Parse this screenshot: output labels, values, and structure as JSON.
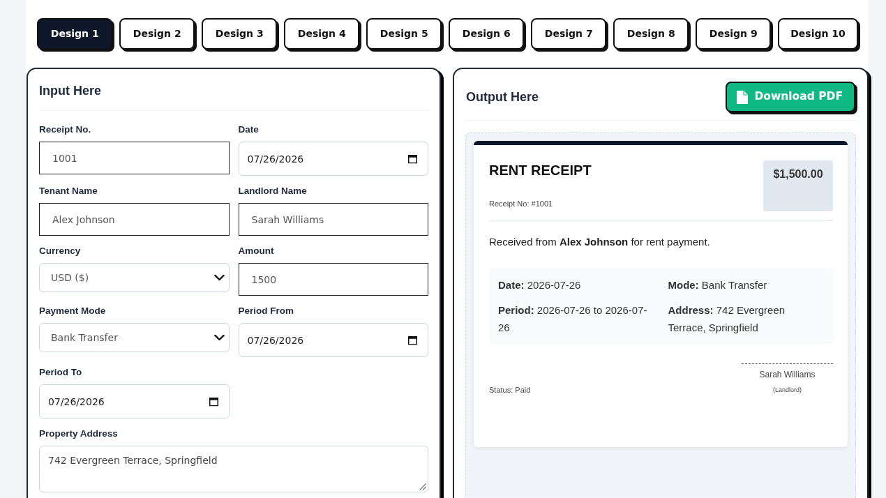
{
  "tabs": [
    {
      "label": "Design 1",
      "selected": true
    },
    {
      "label": "Design 2",
      "selected": false
    },
    {
      "label": "Design 3",
      "selected": false
    },
    {
      "label": "Design 4",
      "selected": false
    },
    {
      "label": "Design 5",
      "selected": false
    },
    {
      "label": "Design 6",
      "selected": false
    },
    {
      "label": "Design 7",
      "selected": false
    },
    {
      "label": "Design 8",
      "selected": false
    },
    {
      "label": "Design 9",
      "selected": false
    },
    {
      "label": "Design 10",
      "selected": false
    }
  ],
  "input_panel": {
    "title": "Input Here",
    "fields": [
      {
        "label": "Receipt No.",
        "kind": "text",
        "value": "1001"
      },
      {
        "label": "Date",
        "kind": "date",
        "value": "07/26/2026"
      },
      {
        "label": "Tenant Name",
        "kind": "text",
        "value": "Alex Johnson"
      },
      {
        "label": "Landlord Name",
        "kind": "text",
        "value": "Sarah Williams"
      },
      {
        "label": "Currency",
        "kind": "select",
        "value": "USD ($)"
      },
      {
        "label": "Amount",
        "kind": "text",
        "value": "1500"
      },
      {
        "label": "Payment Mode",
        "kind": "select",
        "value": "Bank Transfer"
      },
      {
        "label": "Period From",
        "kind": "date",
        "value": "07/26/2026"
      },
      {
        "label": "Period To",
        "kind": "date",
        "value": "07/26/2026"
      },
      {
        "label": "Property Address",
        "kind": "textarea",
        "value": "742 Evergreen Terrace, Springfield"
      }
    ]
  },
  "output_panel": {
    "title": "Output Here",
    "download_button": "Download PDF",
    "receipt": {
      "title": "RENT RECEIPT",
      "amount": "$1,500.00",
      "receipt_no": "Receipt No: #1001",
      "statement": "Received from **Alex Johnson** for rent payment.",
      "details": [
        "**Date:** 2026-07-26",
        "**Mode:** Bank Transfer",
        "**Period:** 2026-07-26 to 2026-07-26",
        "**Address:** 742 Evergreen Terrace, Springfield"
      ],
      "status": "Status: Paid",
      "signature_name": "Sarah Williams",
      "signature_role": "(Landlord)"
    }
  }
}
